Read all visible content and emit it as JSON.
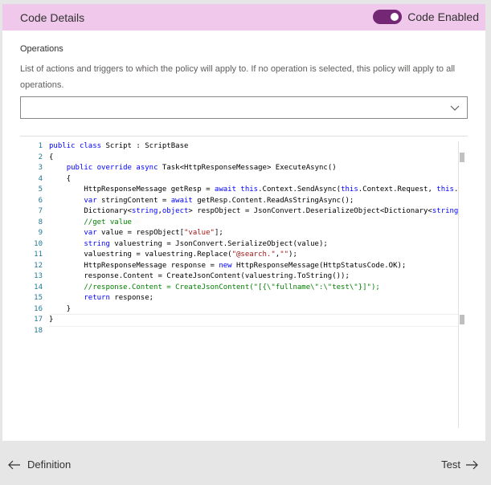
{
  "header": {
    "title": "Code Details",
    "toggle_label": "Code Enabled",
    "toggle_on": true,
    "accent": "#742774",
    "bg": "#efc8eb"
  },
  "operations": {
    "label": "Operations",
    "description": "List of actions and triggers to which the policy will apply to. If no operation is selected, this policy will apply to all operations.",
    "selected": ""
  },
  "editor": {
    "line_numbers": [
      "1",
      "2",
      "3",
      "4",
      "5",
      "6",
      "7",
      "8",
      "9",
      "10",
      "11",
      "12",
      "13",
      "14",
      "15",
      "16",
      "17",
      "18"
    ],
    "lines": [
      "public class Script : ScriptBase",
      "{",
      "    public override async Task<HttpResponseMessage> ExecuteAsync()",
      "    {",
      "        HttpResponseMessage getResp = await this.Context.SendAsync(this.Context.Request, this.Ca",
      "        var stringContent = await getResp.Content.ReadAsStringAsync();",
      "        Dictionary<string,object> respObject = JsonConvert.DeserializeObject<Dictionary<string,o",
      "        //get value",
      "        var value = respObject[\"value\"];",
      "        string valuestring = JsonConvert.SerializeObject(value);",
      "        valuestring = valuestring.Replace(\"@search.\",\"\");",
      "        HttpResponseMessage response = new HttpResponseMessage(HttpStatusCode.OK);",
      "        response.Content = CreateJsonContent(valuestring.ToString());",
      "        //response.Content = CreateJsonContent(\"[{\\\"fullname\\\":\\\"test\\\"}]\");",
      "        return response;",
      "    }",
      "}",
      ""
    ]
  },
  "footer": {
    "back_label": "Definition",
    "next_label": "Test"
  }
}
